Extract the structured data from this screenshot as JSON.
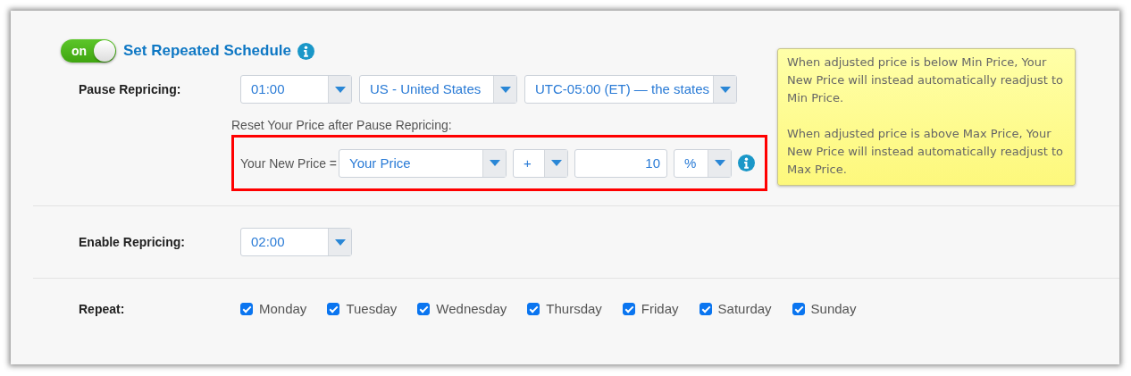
{
  "schedule": {
    "toggle": {
      "label": "on",
      "on": true
    },
    "title": "Set Repeated Schedule"
  },
  "pause": {
    "label": "Pause Repricing:",
    "time": "01:00",
    "country": "US - United States",
    "timezone": "UTC-05:00 (ET) — the states"
  },
  "reset": {
    "label": "Reset Your Price after Pause Repricing:",
    "formula_label": "Your New Price =",
    "base": "Your Price",
    "operator": "+",
    "amount": "10",
    "unit": "%"
  },
  "tooltip": {
    "paragraphs": [
      "When adjusted price is below Min Price, Your New Price will instead automatically readjust to Min Price.",
      "When adjusted price is above Max Price, Your New Price will instead automatically readjust to Max Price."
    ]
  },
  "enable": {
    "label": "Enable Repricing:",
    "time": "02:00"
  },
  "repeat": {
    "label": "Repeat:",
    "days": [
      {
        "label": "Monday",
        "checked": true
      },
      {
        "label": "Tuesday",
        "checked": true
      },
      {
        "label": "Wednesday",
        "checked": true
      },
      {
        "label": "Thursday",
        "checked": true
      },
      {
        "label": "Friday",
        "checked": true
      },
      {
        "label": "Saturday",
        "checked": true
      },
      {
        "label": "Sunday",
        "checked": true
      }
    ]
  }
}
